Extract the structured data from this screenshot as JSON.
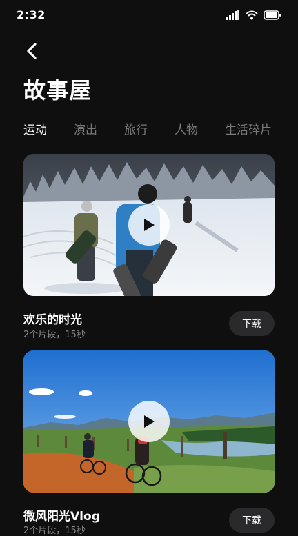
{
  "status": {
    "time": "2:32"
  },
  "page": {
    "title": "故事屋"
  },
  "tabs": [
    {
      "label": "运动",
      "active": true
    },
    {
      "label": "演出",
      "active": false
    },
    {
      "label": "旅行",
      "active": false
    },
    {
      "label": "人物",
      "active": false
    },
    {
      "label": "生活碎片",
      "active": false
    }
  ],
  "cards": [
    {
      "title": "欢乐的时光",
      "meta": "2个片段，15秒",
      "button": "下载"
    },
    {
      "title": "微风阳光Vlog",
      "meta": "2个片段，15秒",
      "button": "下载"
    }
  ],
  "icons": {
    "signal": "signal-icon",
    "wifi": "wifi-icon",
    "battery": "battery-icon",
    "back": "back-arrow-icon",
    "play": "play-icon"
  },
  "colors": {
    "background": "#0f0f10",
    "tab_inactive": "#7a7a7a",
    "button_bg": "#2a2a2c"
  }
}
